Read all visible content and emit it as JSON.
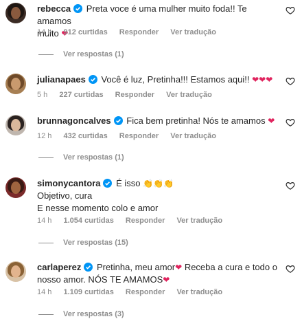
{
  "comments": [
    {
      "username": "rebecca",
      "text_a": "Preta voce é uma mulher muito foda!! Te amamos",
      "text_b": "muito",
      "emoji": "❤",
      "time": "14 h",
      "likes": "912 curtidas",
      "reply": "Responder",
      "translate": "Ver tradução",
      "replies": "Ver respostas (1)"
    },
    {
      "username": "julianapaes",
      "text_a": "Você é luz, Pretinha!!! Estamos aqui!!",
      "emoji": "❤❤❤",
      "time": "5 h",
      "likes": "227 curtidas",
      "reply": "Responder",
      "translate": "Ver tradução"
    },
    {
      "username": "brunnagoncalves",
      "text_a": "Fica bem pretinha! Nós te amamos",
      "emoji": "❤",
      "time": "12 h",
      "likes": "432 curtidas",
      "reply": "Responder",
      "translate": "Ver tradução",
      "replies": "Ver respostas (1)"
    },
    {
      "username": "simonycantora",
      "text_a": "É isso",
      "emoji": "👏👏👏",
      "line2": "Objetivo, cura",
      "line3": "E nesse momento colo e amor",
      "time": "14 h",
      "likes": "1.054 curtidas",
      "reply": "Responder",
      "translate": "Ver tradução",
      "replies": "Ver respostas (15)"
    },
    {
      "username": "carlaperez",
      "text_a": "Pretinha, meu amor",
      "emoji": "❤",
      "text_b": "Receba a cura e todo o",
      "line2": "nosso amor. NÓS TE AMAMOS",
      "emoji2": "❤",
      "time": "14 h",
      "likes": "1.109 curtidas",
      "reply": "Responder",
      "translate": "Ver tradução",
      "replies": "Ver respostas (3)"
    }
  ]
}
